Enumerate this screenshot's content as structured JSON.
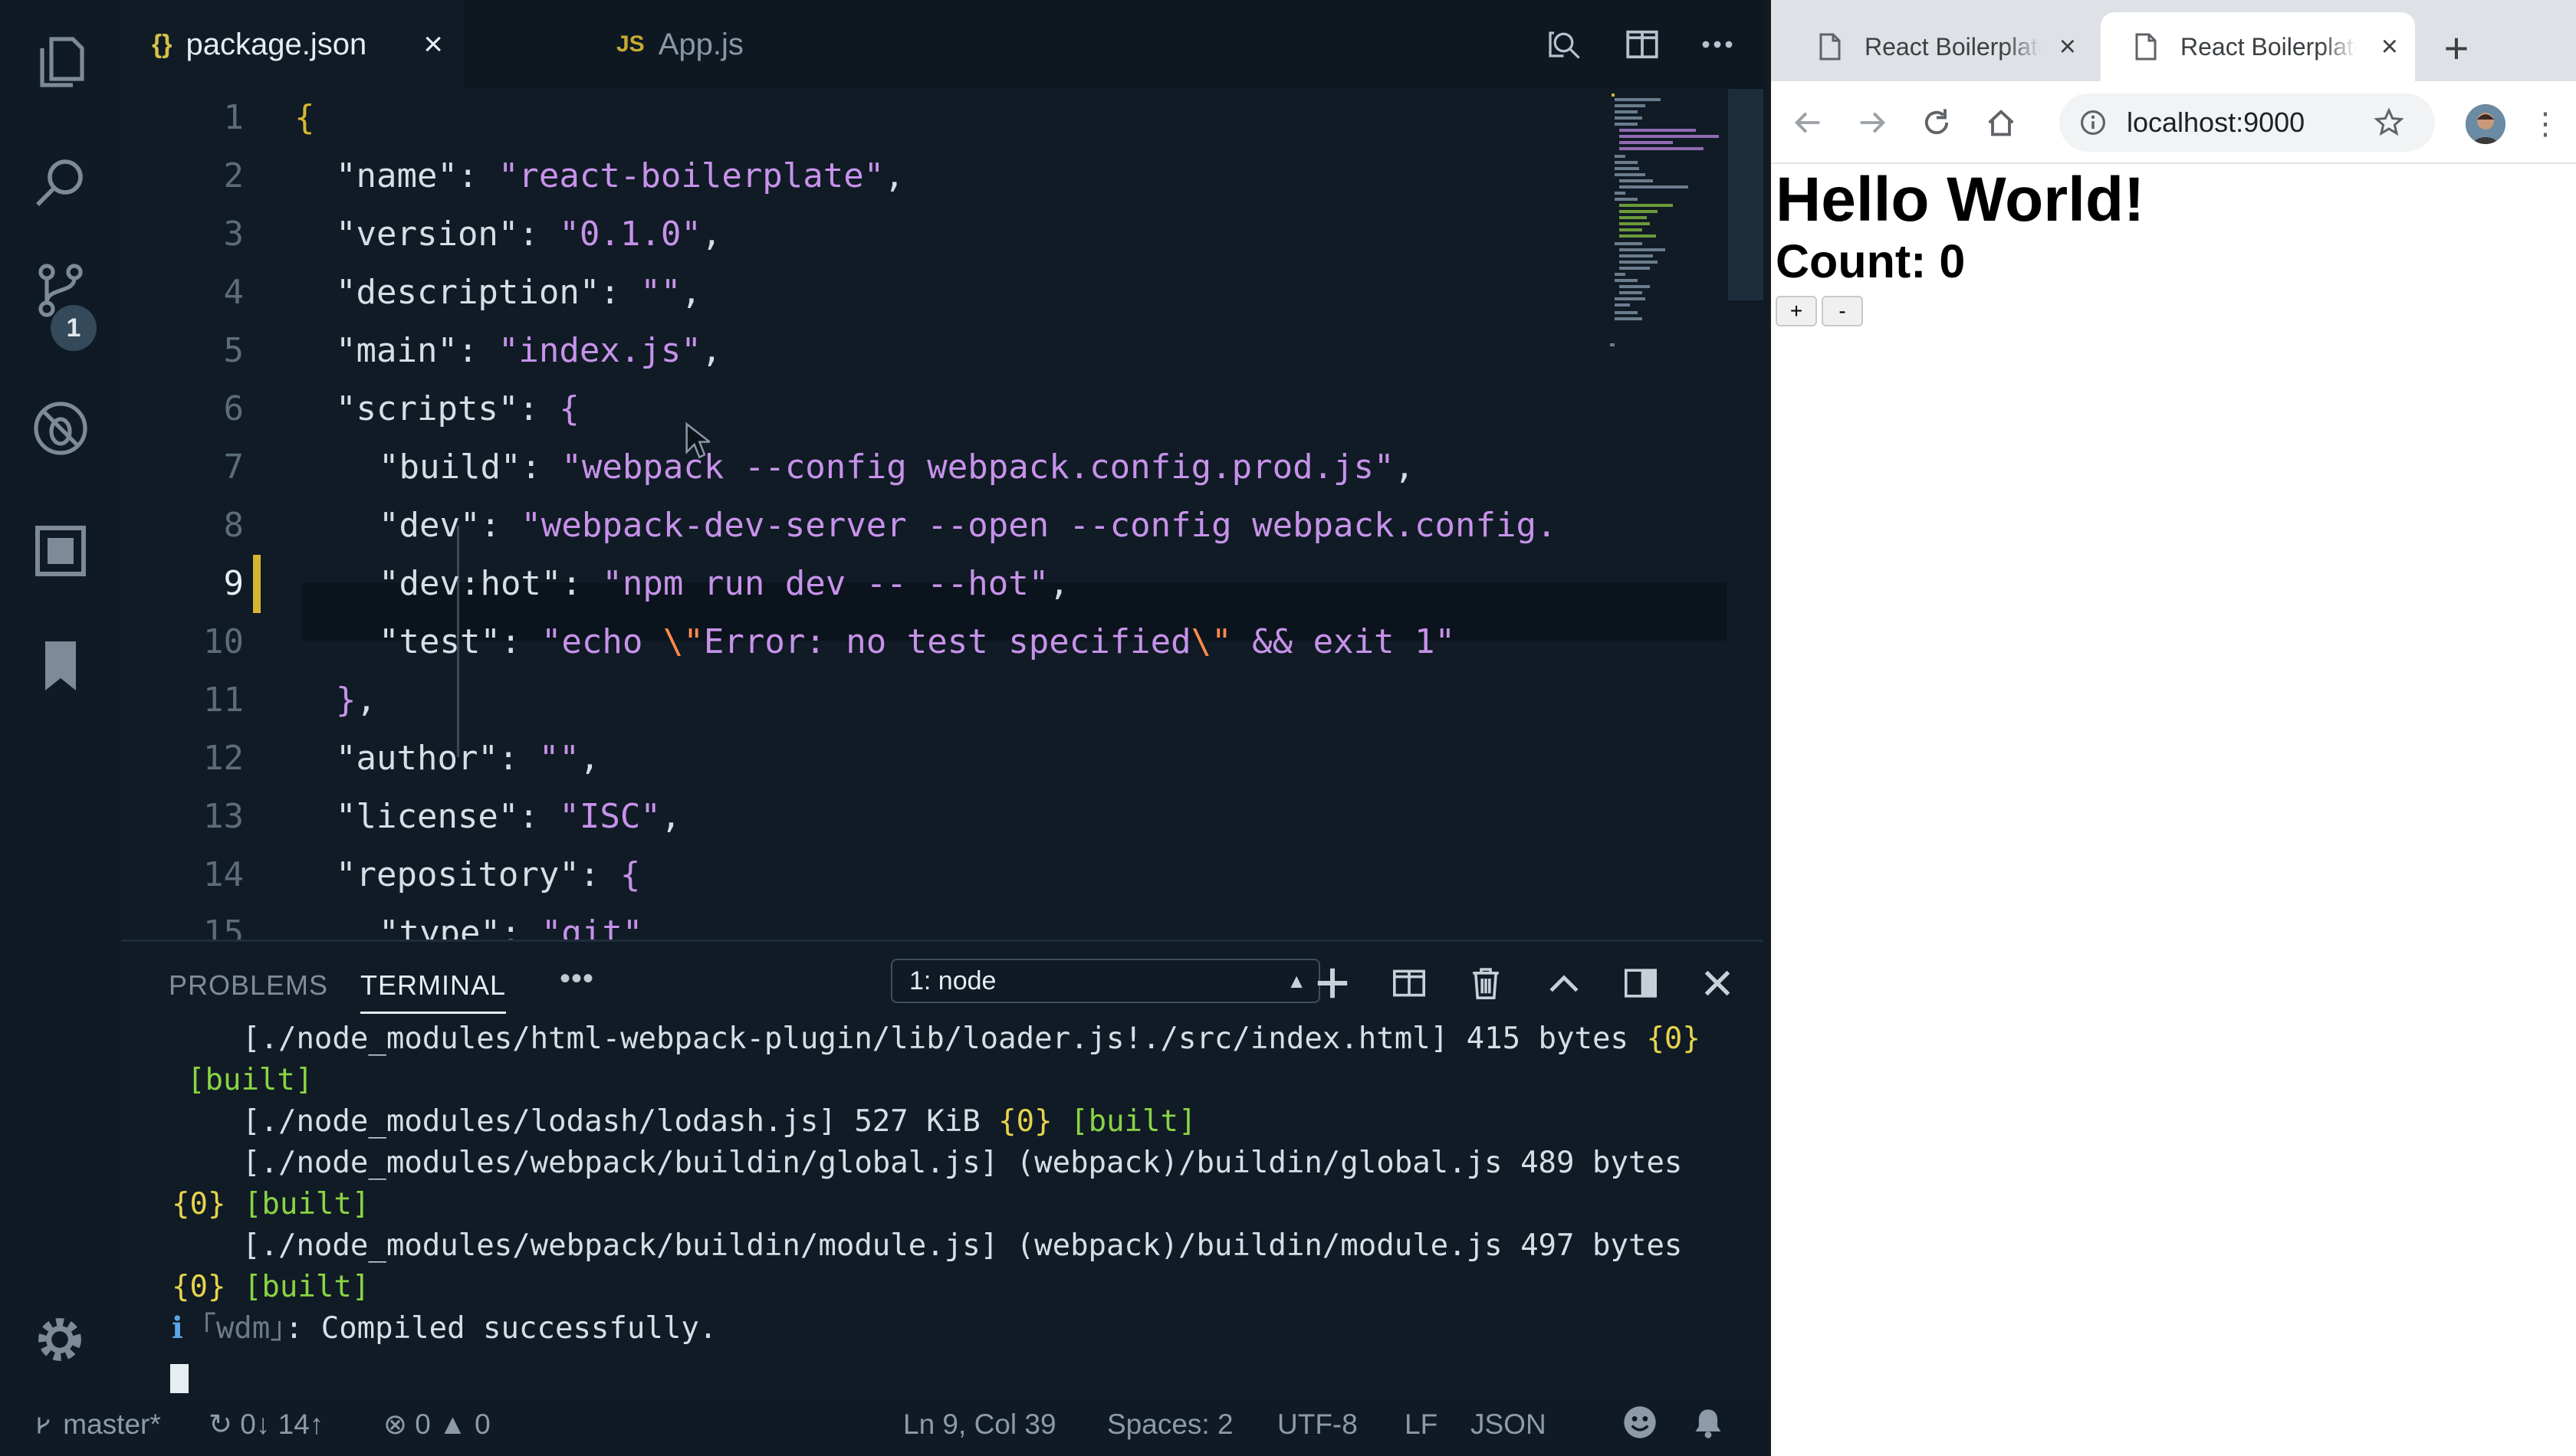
{
  "vscode": {
    "activity_badge": "1",
    "tabs": [
      {
        "icon": "{}",
        "label": "package.json",
        "close": "×"
      },
      {
        "icon": "JS",
        "label": "App.js"
      }
    ],
    "editor": {
      "line_numbers": [
        "1",
        "2",
        "3",
        "4",
        "5",
        "6",
        "7",
        "8",
        "9",
        "10",
        "11",
        "12",
        "13",
        "14",
        "15"
      ],
      "current_line": "9"
    },
    "panel": {
      "tabs": [
        "PROBLEMS",
        "TERMINAL"
      ],
      "more": "•••",
      "terminal_select": "1: node",
      "terminal_lines": {
        "l1": "[./node_modules/html-webpack-plugin/lib/loader.js!./src/index.html] 415 bytes ",
        "l1_chunk": "{0}",
        "built": "[built]",
        "l3": "[./node_modules/lodash/lodash.js] 527 KiB ",
        "l4": "[./node_modules/webpack/buildin/global.js] (webpack)/buildin/global.js 489 bytes",
        "chunk": "{0}",
        "l6": "[./node_modules/webpack/buildin/module.js] (webpack)/buildin/module.js 497 bytes",
        "info": "ℹ",
        "wdm": "｢wdm｣",
        "compiled": ": Compiled successfully."
      }
    },
    "status": {
      "branch": "master*",
      "sync": "0↓ 14↑",
      "errors": "0",
      "warnings": "0",
      "position": "Ln 9, Col 39",
      "spaces": "Spaces: 2",
      "encoding": "UTF-8",
      "eol": "LF",
      "language": "JSON"
    }
  },
  "browser": {
    "tabs": [
      {
        "title": "React Boilerplate",
        "close": "×"
      },
      {
        "title": "React Boilerplate",
        "close": "×"
      }
    ],
    "new_tab": "+",
    "url": "localhost:9000",
    "page": {
      "heading": "Hello World!",
      "count": "Count: 0",
      "plus": "+",
      "minus": "-"
    }
  },
  "colors": {
    "editor_bg": "#101b25",
    "string": "#c792ea",
    "git_modified": "#d6b531",
    "term_green": "#8ad343",
    "term_yellow": "#e6d34c"
  }
}
